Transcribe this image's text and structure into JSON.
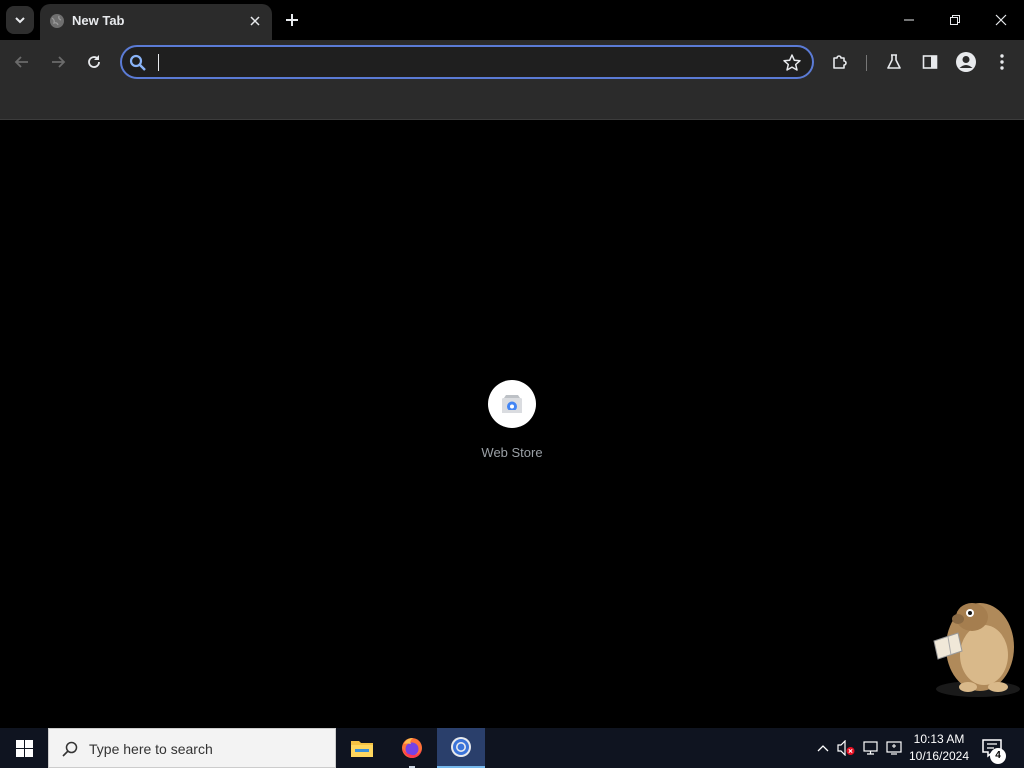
{
  "browser": {
    "tab": {
      "title": "New Tab"
    },
    "omnibox": {
      "value": "",
      "placeholder": ""
    },
    "shortcuts": [
      {
        "label": "Web Store",
        "icon": "chrome-web-store-icon"
      }
    ]
  },
  "taskbar": {
    "search_placeholder": "Type here to search",
    "apps": [
      {
        "name": "File Explorer",
        "icon": "file-explorer-icon"
      },
      {
        "name": "Firefox",
        "icon": "firefox-icon"
      },
      {
        "name": "Google Chrome",
        "icon": "chrome-icon",
        "active": true
      }
    ],
    "clock": {
      "time": "10:13 AM",
      "date": "10/16/2024"
    },
    "notification_count": "4"
  },
  "colors": {
    "accent": "#5b7bd5",
    "toolbar_bg": "#2b2b2b",
    "taskbar_bg": "#0f1420"
  }
}
